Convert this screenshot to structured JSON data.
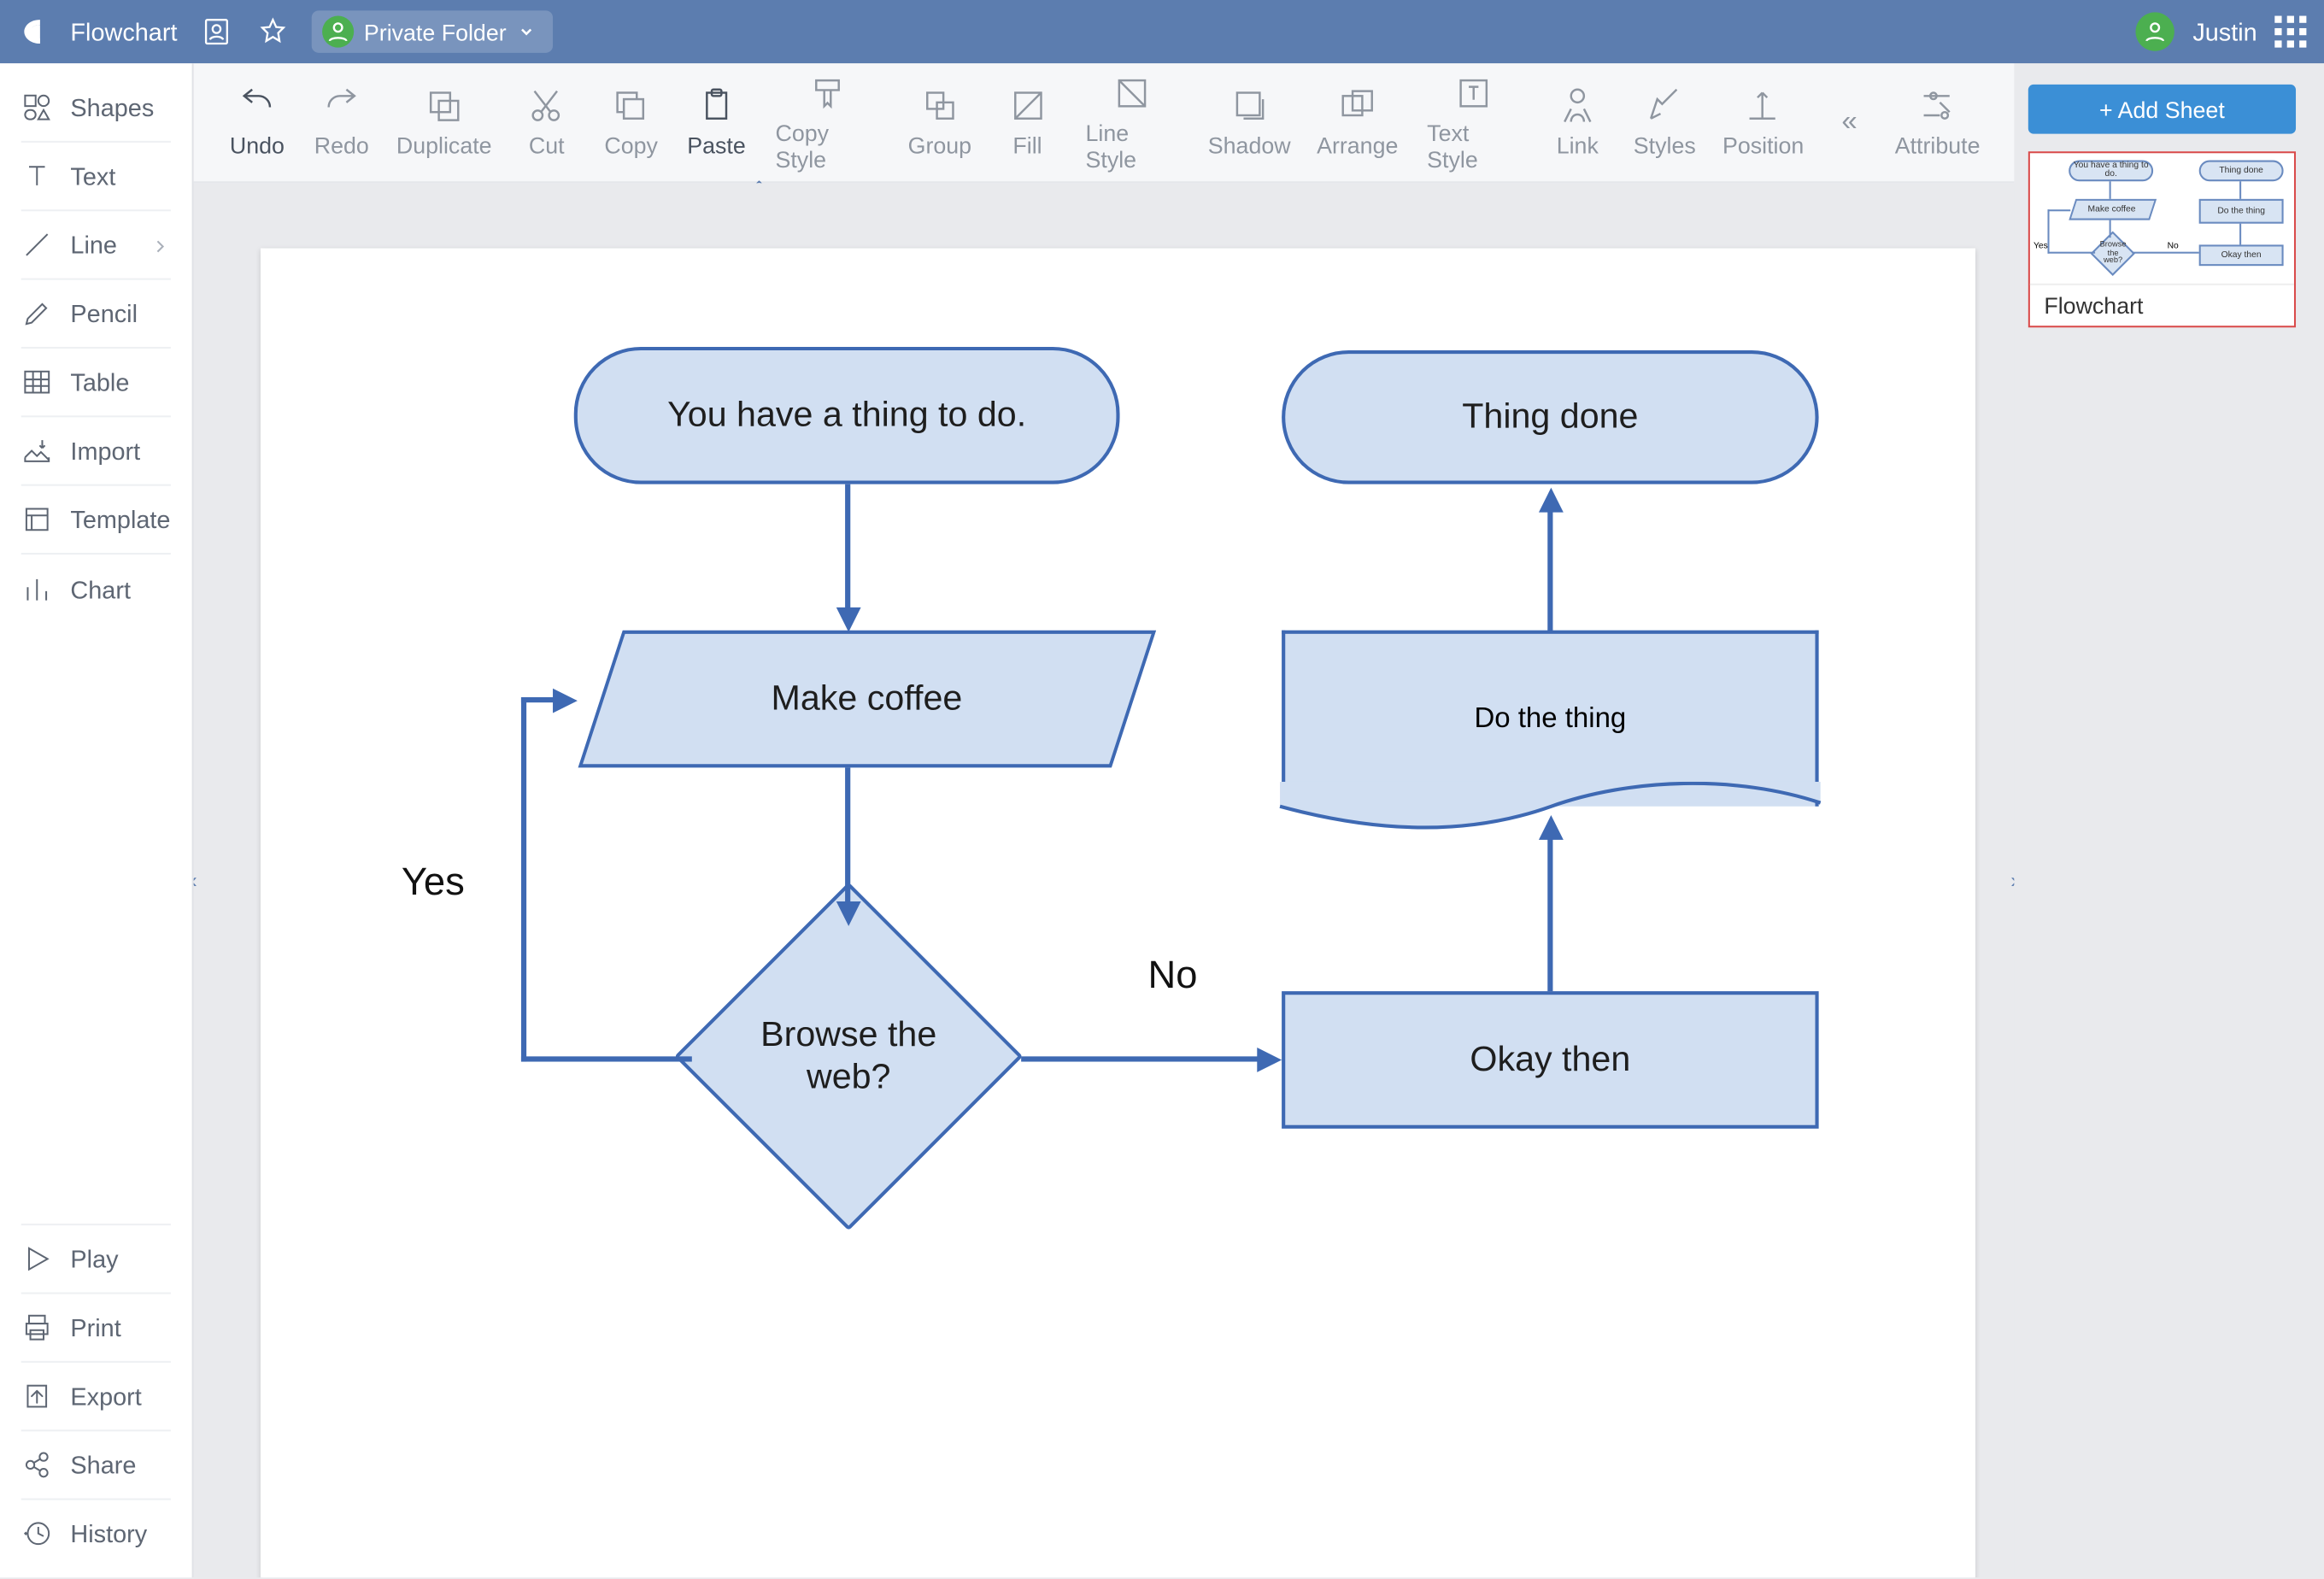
{
  "header": {
    "title": "Flowchart",
    "folder_label": "Private Folder",
    "user_name": "Justin"
  },
  "sidebar": {
    "top": [
      {
        "icon": "shapes",
        "label": "Shapes"
      },
      {
        "icon": "text",
        "label": "Text"
      },
      {
        "icon": "line",
        "label": "Line",
        "has_more": true
      },
      {
        "icon": "pencil",
        "label": "Pencil"
      },
      {
        "icon": "table",
        "label": "Table"
      },
      {
        "icon": "import",
        "label": "Import"
      },
      {
        "icon": "template",
        "label": "Template"
      },
      {
        "icon": "chart",
        "label": "Chart"
      }
    ],
    "bottom": [
      {
        "icon": "play",
        "label": "Play"
      },
      {
        "icon": "print",
        "label": "Print"
      },
      {
        "icon": "export",
        "label": "Export"
      },
      {
        "icon": "share",
        "label": "Share"
      },
      {
        "icon": "history",
        "label": "History"
      }
    ]
  },
  "toolbar": {
    "items": [
      {
        "id": "undo",
        "label": "Undo",
        "active": true
      },
      {
        "id": "redo",
        "label": "Redo"
      },
      {
        "id": "duplicate",
        "label": "Duplicate"
      },
      {
        "id": "cut",
        "label": "Cut"
      },
      {
        "id": "copy",
        "label": "Copy"
      },
      {
        "id": "paste",
        "label": "Paste",
        "active": true
      },
      {
        "id": "copystyle",
        "label": "Copy Style"
      },
      {
        "id": "group",
        "label": "Group"
      },
      {
        "id": "fill",
        "label": "Fill"
      },
      {
        "id": "linestyle",
        "label": "Line Style"
      },
      {
        "id": "shadow",
        "label": "Shadow"
      },
      {
        "id": "arrange",
        "label": "Arrange"
      },
      {
        "id": "textstyle",
        "label": "Text Style"
      },
      {
        "id": "link",
        "label": "Link"
      },
      {
        "id": "styles",
        "label": "Styles"
      },
      {
        "id": "position",
        "label": "Position"
      }
    ],
    "overflow_item": {
      "id": "attribute",
      "label": "Attribute"
    }
  },
  "right_panel": {
    "add_sheet_label": "+ Add Sheet",
    "thumb_label": "Flowchart"
  },
  "flow": {
    "nodes": {
      "start": "You have a thing to do.",
      "done": "Thing done",
      "coffee": "Make coffee",
      "do": "Do the thing",
      "browse": "Browse the web?",
      "okay": "Okay then"
    },
    "labels": {
      "yes": "Yes",
      "no": "No"
    }
  },
  "chart_data": {
    "type": "flowchart",
    "nodes": [
      {
        "id": "start",
        "shape": "terminator",
        "text": "You have a thing to do."
      },
      {
        "id": "coffee",
        "shape": "io",
        "text": "Make coffee"
      },
      {
        "id": "browse",
        "shape": "decision",
        "text": "Browse the web?"
      },
      {
        "id": "okay",
        "shape": "process",
        "text": "Okay then"
      },
      {
        "id": "do",
        "shape": "document",
        "text": "Do the thing"
      },
      {
        "id": "done",
        "shape": "terminator",
        "text": "Thing done"
      }
    ],
    "edges": [
      {
        "from": "start",
        "to": "coffee"
      },
      {
        "from": "coffee",
        "to": "browse"
      },
      {
        "from": "browse",
        "to": "coffee",
        "label": "Yes"
      },
      {
        "from": "browse",
        "to": "okay",
        "label": "No"
      },
      {
        "from": "okay",
        "to": "do"
      },
      {
        "from": "do",
        "to": "done"
      }
    ]
  }
}
